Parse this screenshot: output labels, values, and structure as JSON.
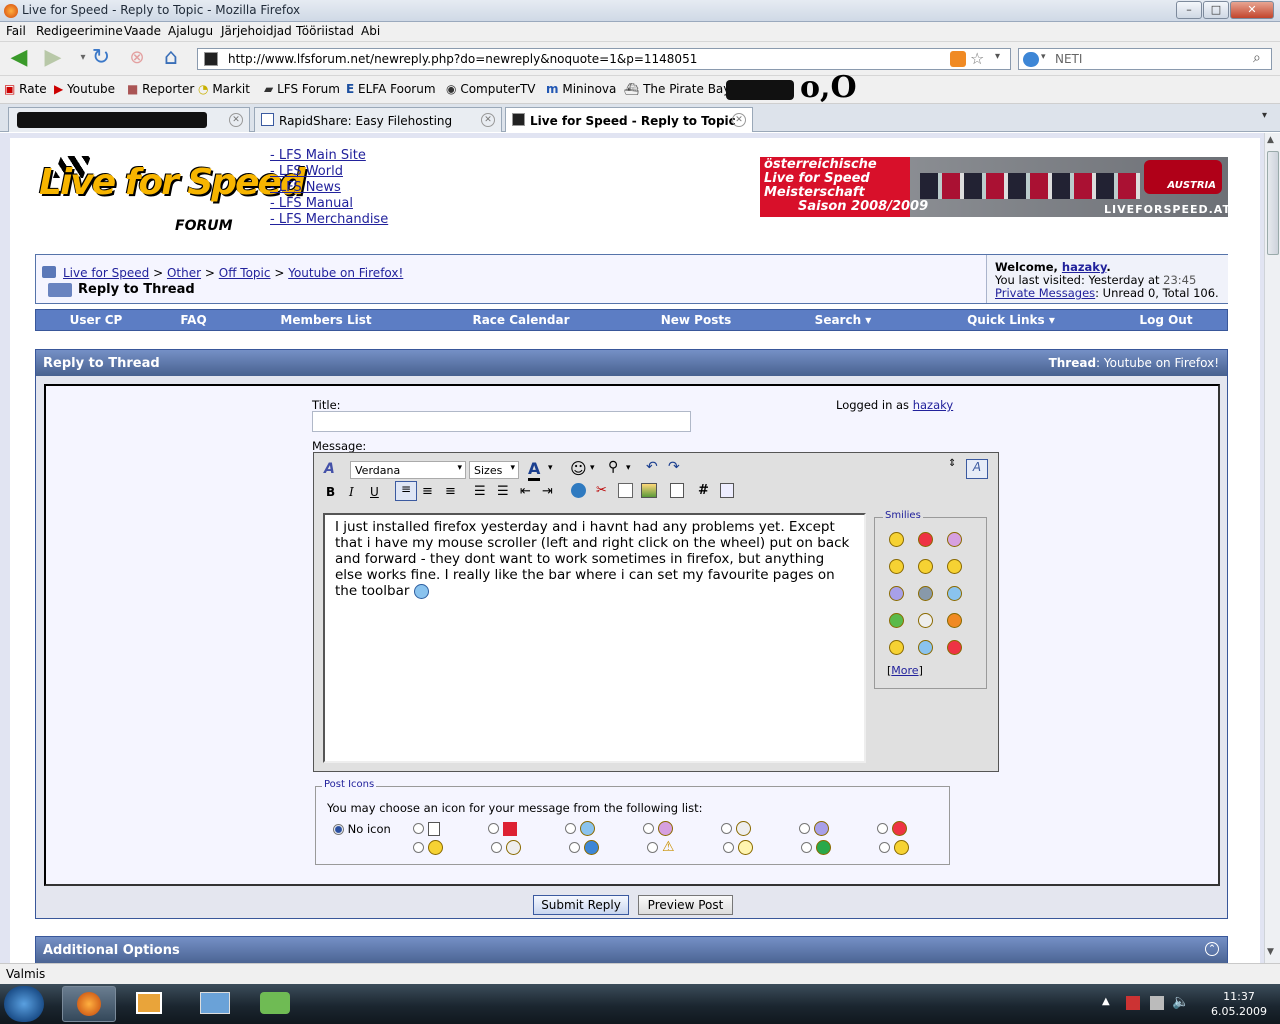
{
  "window": {
    "title": "Live for Speed - Reply to Topic - Mozilla Firefox",
    "min": "–",
    "max": "□",
    "close": "✕"
  },
  "menu": [
    "Fail",
    "Redigeerimine",
    "Vaade",
    "Ajalugu",
    "Järjehoidjad",
    "Tööriistad",
    "Abi"
  ],
  "url": "http://www.lfsforum.net/newreply.php?do=newreply&noquote=1&p=1148051",
  "search_placeholder": "NETI",
  "bookmarks": [
    "Rate",
    "Youtube",
    "Reporter",
    "Markit",
    "LFS Forum",
    "ELFA Foorum",
    "ComputerTV",
    "Mininova",
    "The Pirate Bay",
    "o,O"
  ],
  "tabs": [
    {
      "label": ""
    },
    {
      "label": "RapidShare: Easy Filehosting"
    },
    {
      "label": "Live for Speed - Reply to Topic"
    }
  ],
  "site": {
    "logo_text": "Live for Speed",
    "logo_sub": "FORUM",
    "top_links": [
      "- LFS Main Site",
      "- LFS World",
      "- LFS News",
      "- LFS Manual",
      "- LFS Merchandise"
    ],
    "banner": {
      "line1": "österreichische",
      "line2": "Live for Speed",
      "line3": "Meisterschaft",
      "line4": "Saison 2008/2009",
      "brand": "LIVEFORSPEED.AT",
      "badge": "AUSTRIA"
    }
  },
  "breadcrumb": {
    "items": [
      "Live for Speed",
      "Other",
      "Off Topic",
      "Youtube on Firefox!"
    ],
    "sep": ">",
    "current": "Reply to Thread"
  },
  "welcome": {
    "prefix": "Welcome, ",
    "user": "hazaky",
    "suffix": ".",
    "visited_label": "You last visited: Yesterday at ",
    "visited_time": "23:45",
    "pm_label": "Private Messages",
    "pm_text": ": Unread 0, Total 106."
  },
  "navbar": [
    "User CP",
    "FAQ",
    "Members List",
    "Race Calendar",
    "New Posts",
    "Search ▾",
    "Quick Links ▾",
    "Log Out"
  ],
  "reply": {
    "header": "Reply to Thread",
    "thread_label": "Thread",
    "thread_name": ": Youtube on Firefox!",
    "title_label": "Title:",
    "logged_label": "Logged in as ",
    "logged_user": "hazaky",
    "message_label": "Message:",
    "font": "Verdana",
    "sizes": "Sizes",
    "message": "I just installed firefox yesterday and i havnt had any problems yet. Except that i have my mouse scroller (left and right click on the wheel) put on back and forward - they dont want to work sometimes in firefox, but anything else works fine. I really like the bar where i can set my favourite pages on the toolbar",
    "smilies_title": "Smilies",
    "smilies_more": "More",
    "post_icons_title": "Post Icons",
    "post_icons_desc": "You may choose an icon for your message from the following list:",
    "no_icon": "No icon",
    "submit": "Submit Reply",
    "preview": "Preview Post"
  },
  "additional_options": "Additional Options",
  "status": "Valmis",
  "clock": {
    "time": "11:37",
    "date": "6.05.2009"
  },
  "colors": {
    "nav_blue": "#5c7dc4",
    "header_blue": "#48618f",
    "link": "#22229c"
  }
}
